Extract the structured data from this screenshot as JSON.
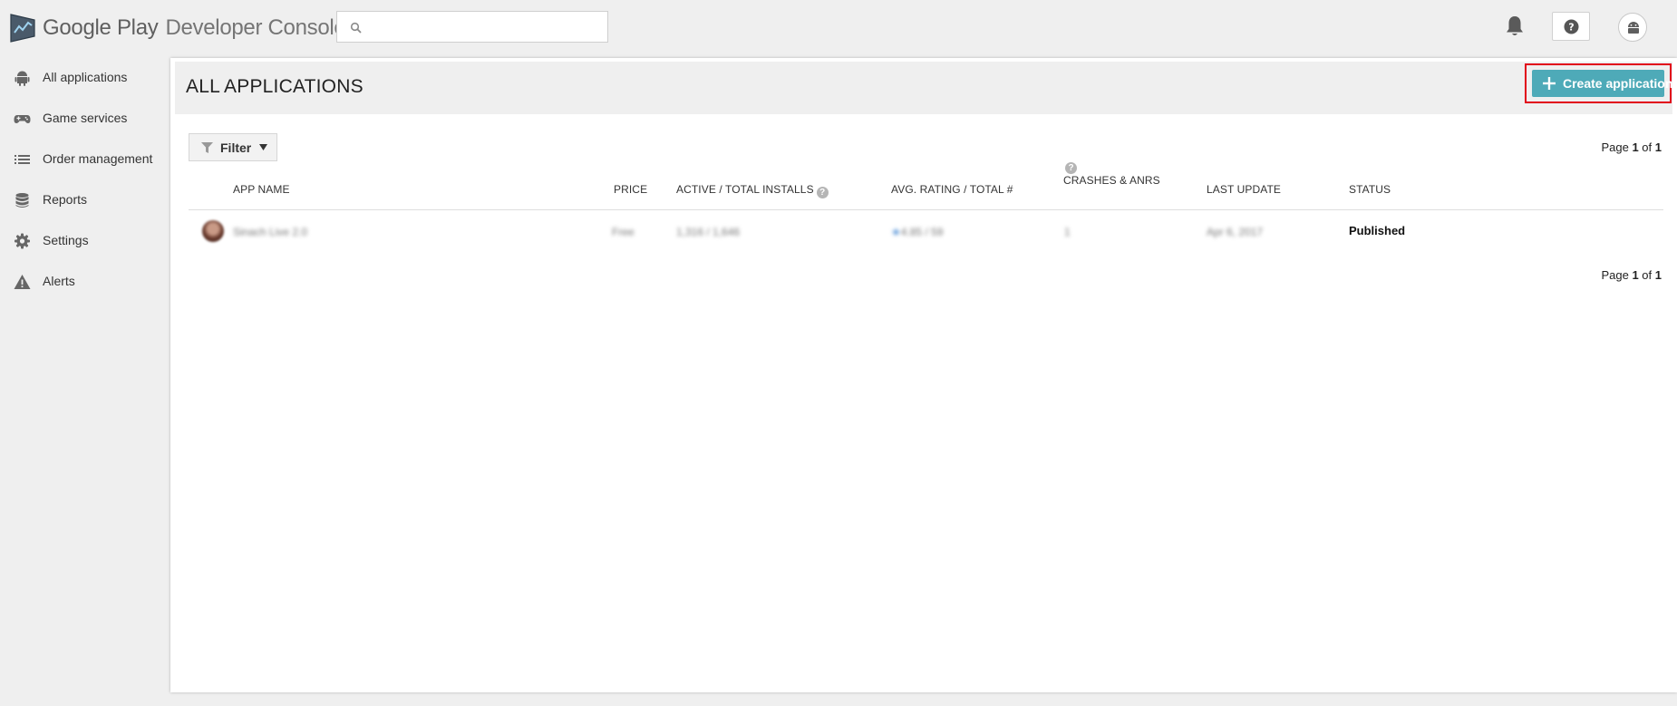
{
  "brand": {
    "part1": "Google Play",
    "part2": "Developer Console"
  },
  "search": {
    "placeholder": "",
    "value": ""
  },
  "sidebar": {
    "items": [
      {
        "label": "All applications",
        "icon": "android-icon"
      },
      {
        "label": "Game services",
        "icon": "gamepad-icon"
      },
      {
        "label": "Order management",
        "icon": "list-icon"
      },
      {
        "label": "Reports",
        "icon": "database-icon"
      },
      {
        "label": "Settings",
        "icon": "gear-icon"
      },
      {
        "label": "Alerts",
        "icon": "warning-icon"
      }
    ]
  },
  "main": {
    "title": "ALL APPLICATIONS",
    "create_button": "Create application",
    "filter_label": "Filter",
    "pager": {
      "prefix": "Page ",
      "current": "1",
      "of": " of ",
      "total": "1"
    },
    "columns": {
      "app_name": "APP NAME",
      "price": "PRICE",
      "installs": "ACTIVE / TOTAL INSTALLS",
      "rating": "AVG. RATING / TOTAL #",
      "crashes": "CRASHES & ANRS",
      "last_update": "LAST UPDATE",
      "status": "STATUS"
    },
    "rows": [
      {
        "app_name": "Sinach Live 2.0",
        "price": "Free",
        "installs": "1,316  /  1,646",
        "rating_star": "★",
        "rating": "4.85  /  59",
        "crashes": "1",
        "last_update": "Apr 6, 2017",
        "status": "Published"
      }
    ]
  },
  "colors": {
    "accent": "#4eaab8",
    "highlight_border": "#e1001a",
    "star": "#4e8fd6",
    "background": "#efefef"
  }
}
